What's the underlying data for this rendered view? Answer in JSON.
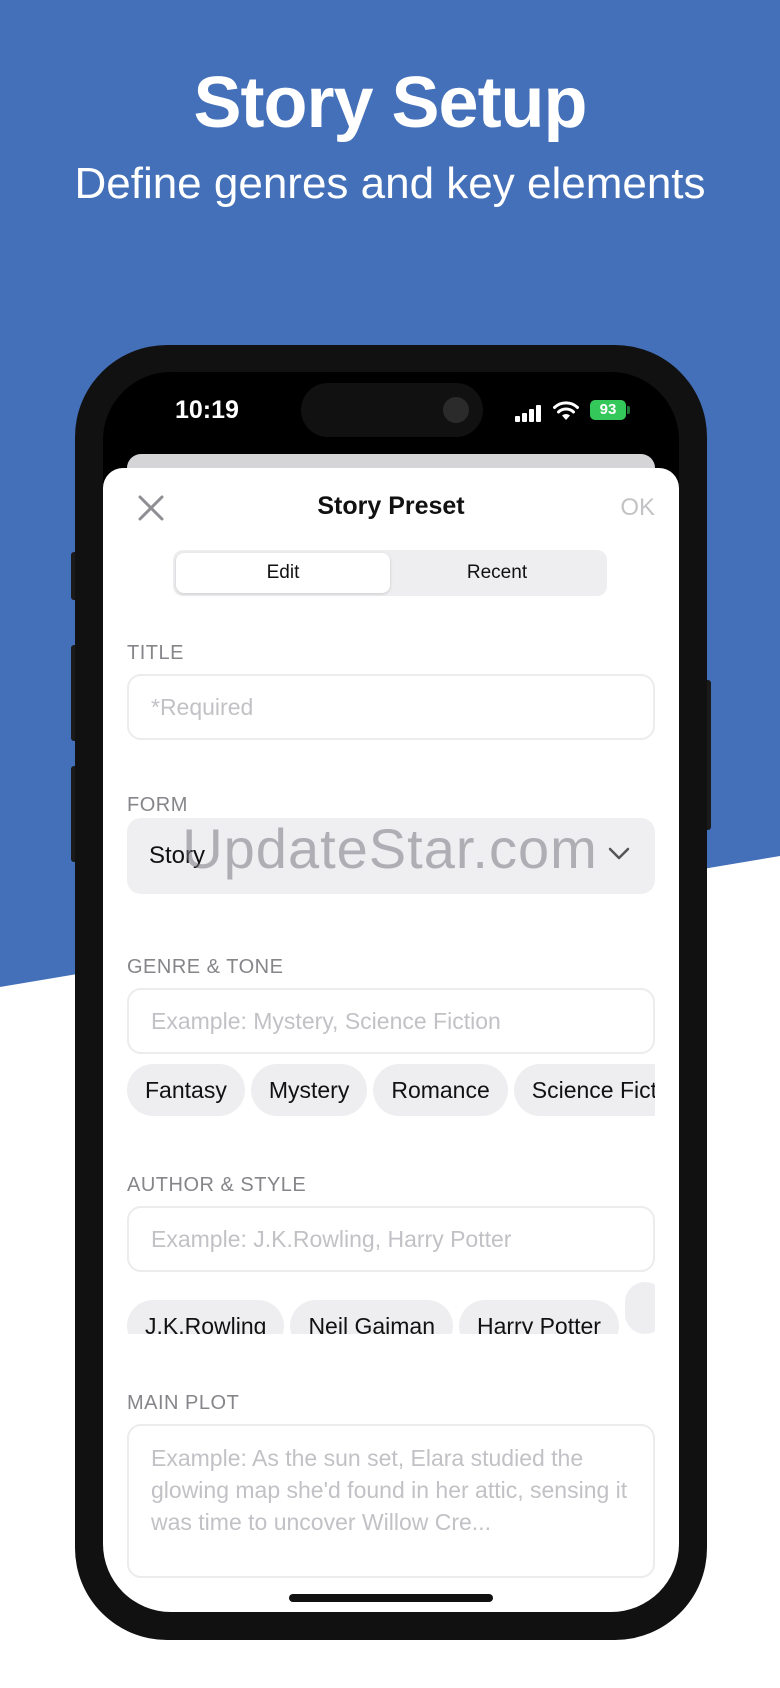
{
  "headline": {
    "title": "Story Setup",
    "subtitle": "Define genres and key elements"
  },
  "status_bar": {
    "time": "10:19",
    "battery": "93"
  },
  "nav": {
    "title": "Story Preset",
    "ok_label": "OK"
  },
  "segments": [
    "Edit",
    "Recent"
  ],
  "form": {
    "title_label": "TITLE",
    "title_placeholder": "*Required",
    "form_label": "FORM",
    "form_value": "Story",
    "genre_label": "GENRE & TONE",
    "genre_placeholder": "Example: Mystery, Science Fiction",
    "genre_chips": [
      "Fantasy",
      "Mystery",
      "Romance",
      "Science Fiction"
    ],
    "author_label": "AUTHOR & STYLE",
    "author_placeholder": "Example: J.K.Rowling, Harry Potter",
    "author_chips": [
      "J.K.Rowling",
      "Neil Gaiman",
      "Harry Potter",
      ""
    ],
    "plot_label": "MAIN PLOT",
    "plot_placeholder": "Example: As the sun set, Elara studied the glowing map she'd found in her attic, sensing it was time to uncover Willow Cre..."
  },
  "watermark": "UpdateStar.com",
  "colors": {
    "background_blue": "#4470b9",
    "battery_green": "#34c759"
  }
}
